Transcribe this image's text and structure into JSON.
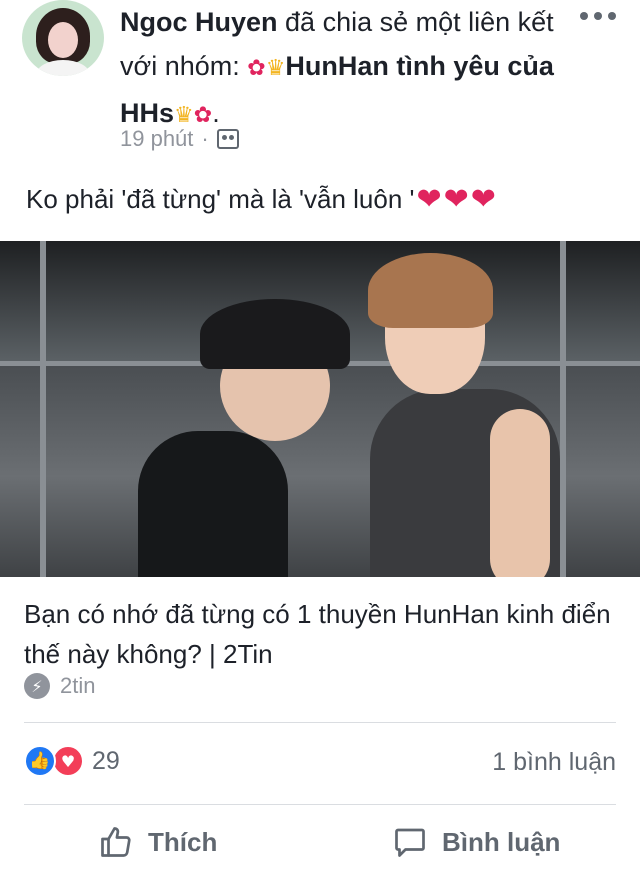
{
  "post": {
    "author": "Ngoc Huyen",
    "action_text": " đã chia sẻ một liên kết với nhóm: ",
    "group_name": "HunHan tình yêu của HHs",
    "trailing": ".",
    "time": "19 phút",
    "separator": "·",
    "caption": "Ko phải 'đã từng' mà là 'vẫn luôn '",
    "caption_hearts": "❤❤❤"
  },
  "link": {
    "title": "Bạn có nhớ đã từng có 1 thuyền HunHan kinh điển thế này không? | 2Tin",
    "source": "2tin"
  },
  "stats": {
    "reaction_count": "29",
    "comments": "1 bình luận"
  },
  "actions": {
    "like_label": "Thích",
    "comment_label": "Bình luận"
  },
  "icons": {
    "flower": "hibiscus-icon",
    "crown": "crown-icon",
    "audience": "group-audience-icon",
    "more": "more-options-icon",
    "bolt": "instant-article-bolt-icon",
    "like_reaction": "like-reaction-icon",
    "love_reaction": "love-reaction-icon",
    "like_action": "thumbs-up-icon",
    "comment_action": "comment-bubble-icon"
  },
  "colors": {
    "text": "#1d2129",
    "muted": "#90949c",
    "like_blue": "#2078f4",
    "love_red": "#f33e58",
    "heart": "#e0245e"
  }
}
